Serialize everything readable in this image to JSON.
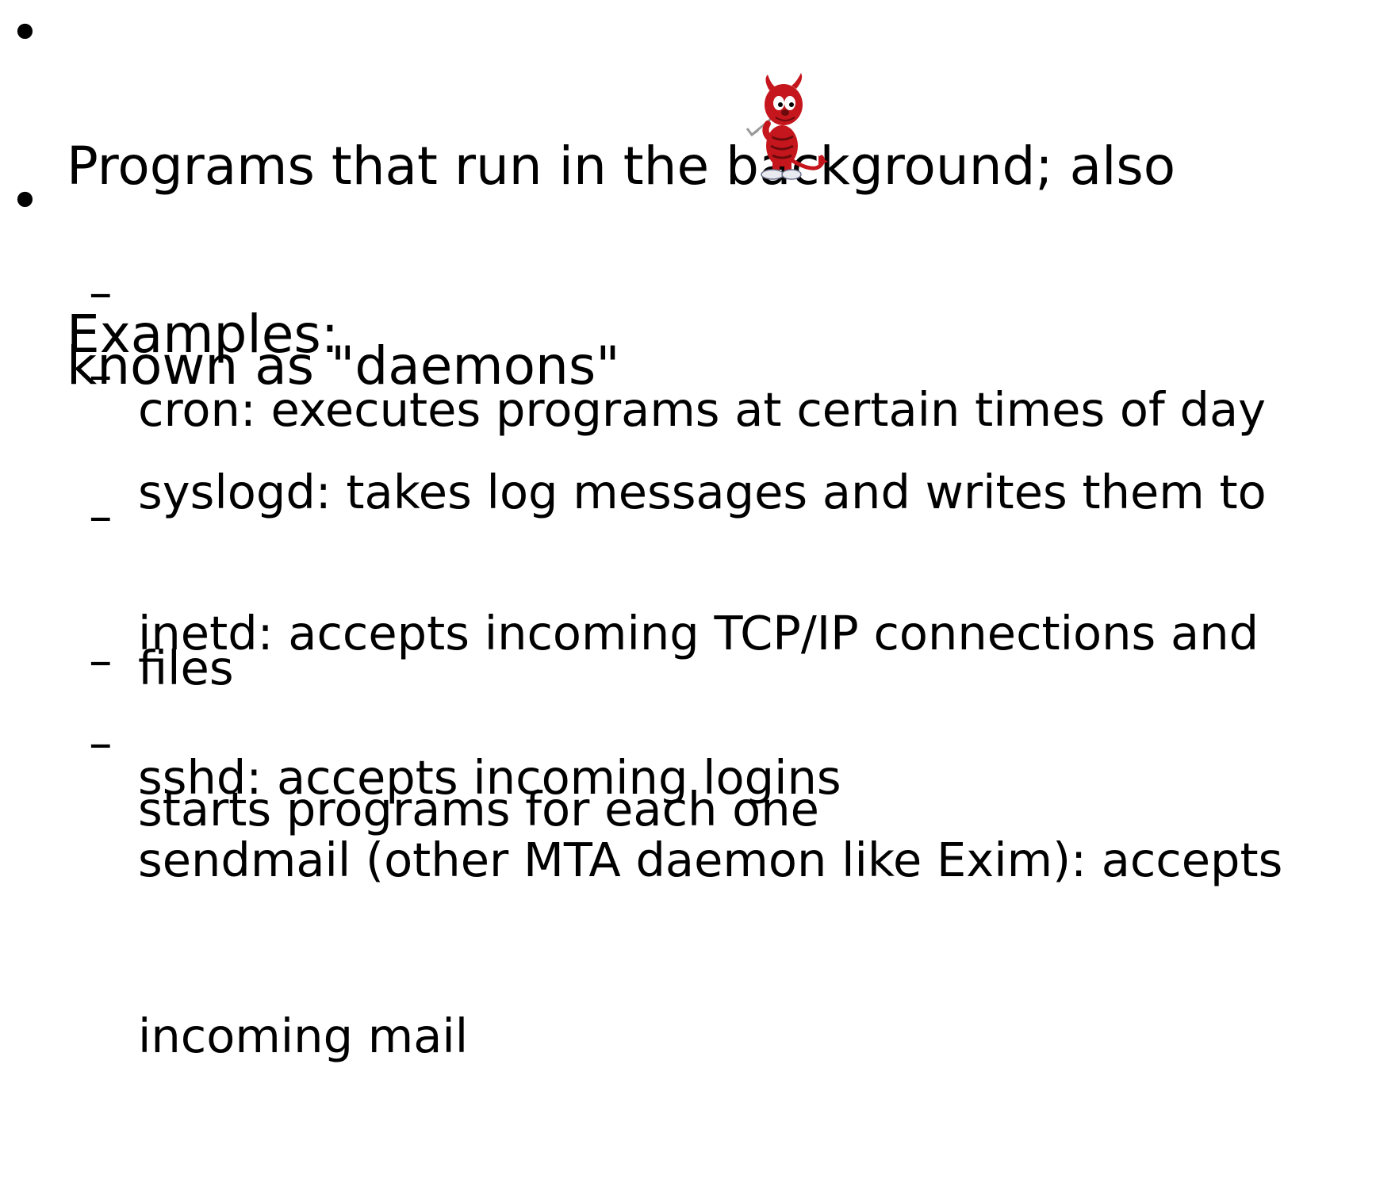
{
  "bullets": {
    "marker": "•",
    "item1": {
      "line1": "Programs that run in the background; also",
      "line2": "known as \"daemons\""
    },
    "item2": {
      "text": "Examples:"
    }
  },
  "subbullets": {
    "marker": "–",
    "cron": {
      "line1": "cron: executes programs at certain times of day"
    },
    "syslogd": {
      "line1": "syslogd: takes log messages and writes them to",
      "line2": "files"
    },
    "inetd": {
      "line1": "inetd: accepts incoming TCP/IP connections and",
      "line2": "starts programs for each one"
    },
    "sshd": {
      "line1": "sshd: accepts incoming logins"
    },
    "sendmail": {
      "line1": "sendmail (other MTA daemon like Exim): accepts",
      "line2": "incoming mail"
    }
  },
  "mascot": {
    "icon": "bsd-daemon-icon",
    "colors": {
      "body": "#c4161c",
      "dark": "#6b0a0c",
      "shoe": "#e8eaf0",
      "skin": "#f2d2b6"
    }
  }
}
